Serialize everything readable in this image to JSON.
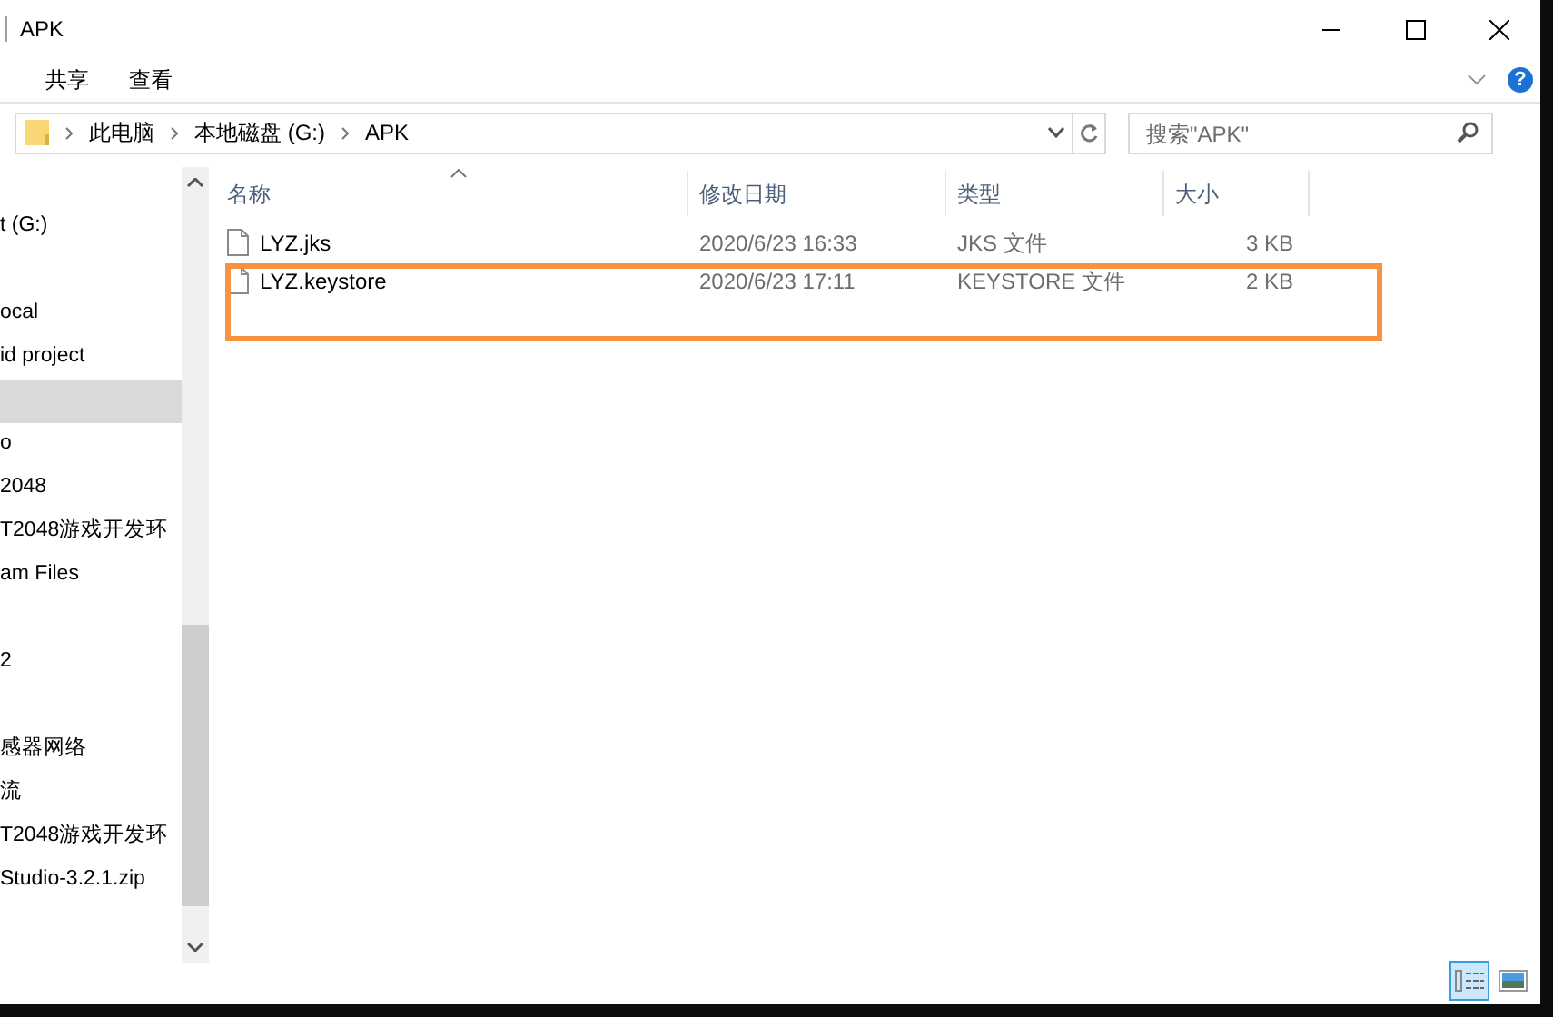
{
  "window": {
    "title": "APK"
  },
  "ribbon_tabs": [
    {
      "label": "共享",
      "selected": false
    },
    {
      "label": "查看",
      "selected": false
    }
  ],
  "address_bar": {
    "segments": [
      "此电脑",
      "本地磁盘 (G:)",
      "APK"
    ]
  },
  "help_button": {
    "label": "?"
  },
  "search": {
    "placeholder": "搜索\"APK\""
  },
  "nav_pane": {
    "items": [
      {
        "label": "t (G:)",
        "selected": false
      },
      {
        "selected": false
      },
      {
        "label": "ocal",
        "selected": false
      },
      {
        "label": "id project",
        "selected": false
      },
      {
        "selected": true
      },
      {
        "label": "o",
        "selected": false
      },
      {
        "label": "2048",
        "selected": false
      },
      {
        "label": "T2048游戏开发环",
        "selected": false
      },
      {
        "label": "am Files",
        "selected": false
      },
      {
        "selected": false
      },
      {
        "label": "2",
        "selected": false
      },
      {
        "selected": false
      },
      {
        "label": "感器网络",
        "selected": false
      },
      {
        "label": "流",
        "selected": false
      },
      {
        "label": "T2048游戏开发环",
        "selected": false
      },
      {
        "label": "Studio-3.2.1.zip",
        "selected": false
      }
    ]
  },
  "table": {
    "columns": [
      "名称",
      "修改日期",
      "类型",
      "大小"
    ],
    "rows": [
      {
        "name": "LYZ.jks",
        "modified": "2020/6/23 16:33",
        "type": "JKS 文件",
        "size": "3 KB",
        "highlighted": false
      },
      {
        "name": "LYZ.keystore",
        "modified": "2020/6/23 17:11",
        "type": "KEYSTORE 文件",
        "size": "2 KB",
        "highlighted": true
      }
    ]
  },
  "view_buttons": [
    {
      "kind": "details",
      "selected": true
    },
    {
      "kind": "thumbnails",
      "selected": false
    }
  ]
}
